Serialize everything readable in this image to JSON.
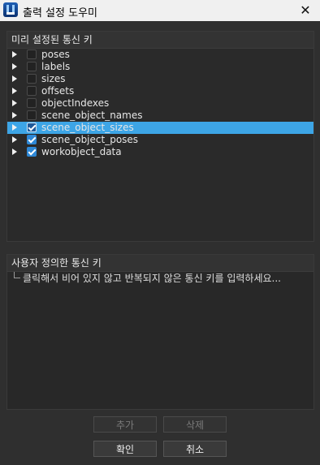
{
  "window": {
    "title": "출력 설정 도우미",
    "close_glyph": "✕"
  },
  "preset_panel": {
    "header": "미리 설정된 통신 키",
    "items": [
      {
        "label": "poses",
        "checked": false
      },
      {
        "label": "labels",
        "checked": false
      },
      {
        "label": "sizes",
        "checked": false
      },
      {
        "label": "offsets",
        "checked": false
      },
      {
        "label": "objectIndexes",
        "checked": false
      },
      {
        "label": "scene_object_names",
        "checked": false
      },
      {
        "label": "scene_object_sizes",
        "checked": true,
        "selected": true
      },
      {
        "label": "scene_object_poses",
        "checked": true
      },
      {
        "label": "workobject_data",
        "checked": true
      }
    ]
  },
  "custom_panel": {
    "header": "사용자 정의한 통신 키",
    "hint": "클릭해서 비어 있지 않고 반복되지 않은 통신 키를 입력하세요..."
  },
  "buttons": {
    "add": "추가",
    "delete": "삭제",
    "ok": "확인",
    "cancel": "취소"
  },
  "colors": {
    "selection": "#3da5e6",
    "checkbox_checked": "#2e88d6",
    "background": "#2f2f2f"
  },
  "icons": {
    "app": "app-logo-icon",
    "close": "close-icon",
    "expand": "expand-arrow-icon"
  }
}
